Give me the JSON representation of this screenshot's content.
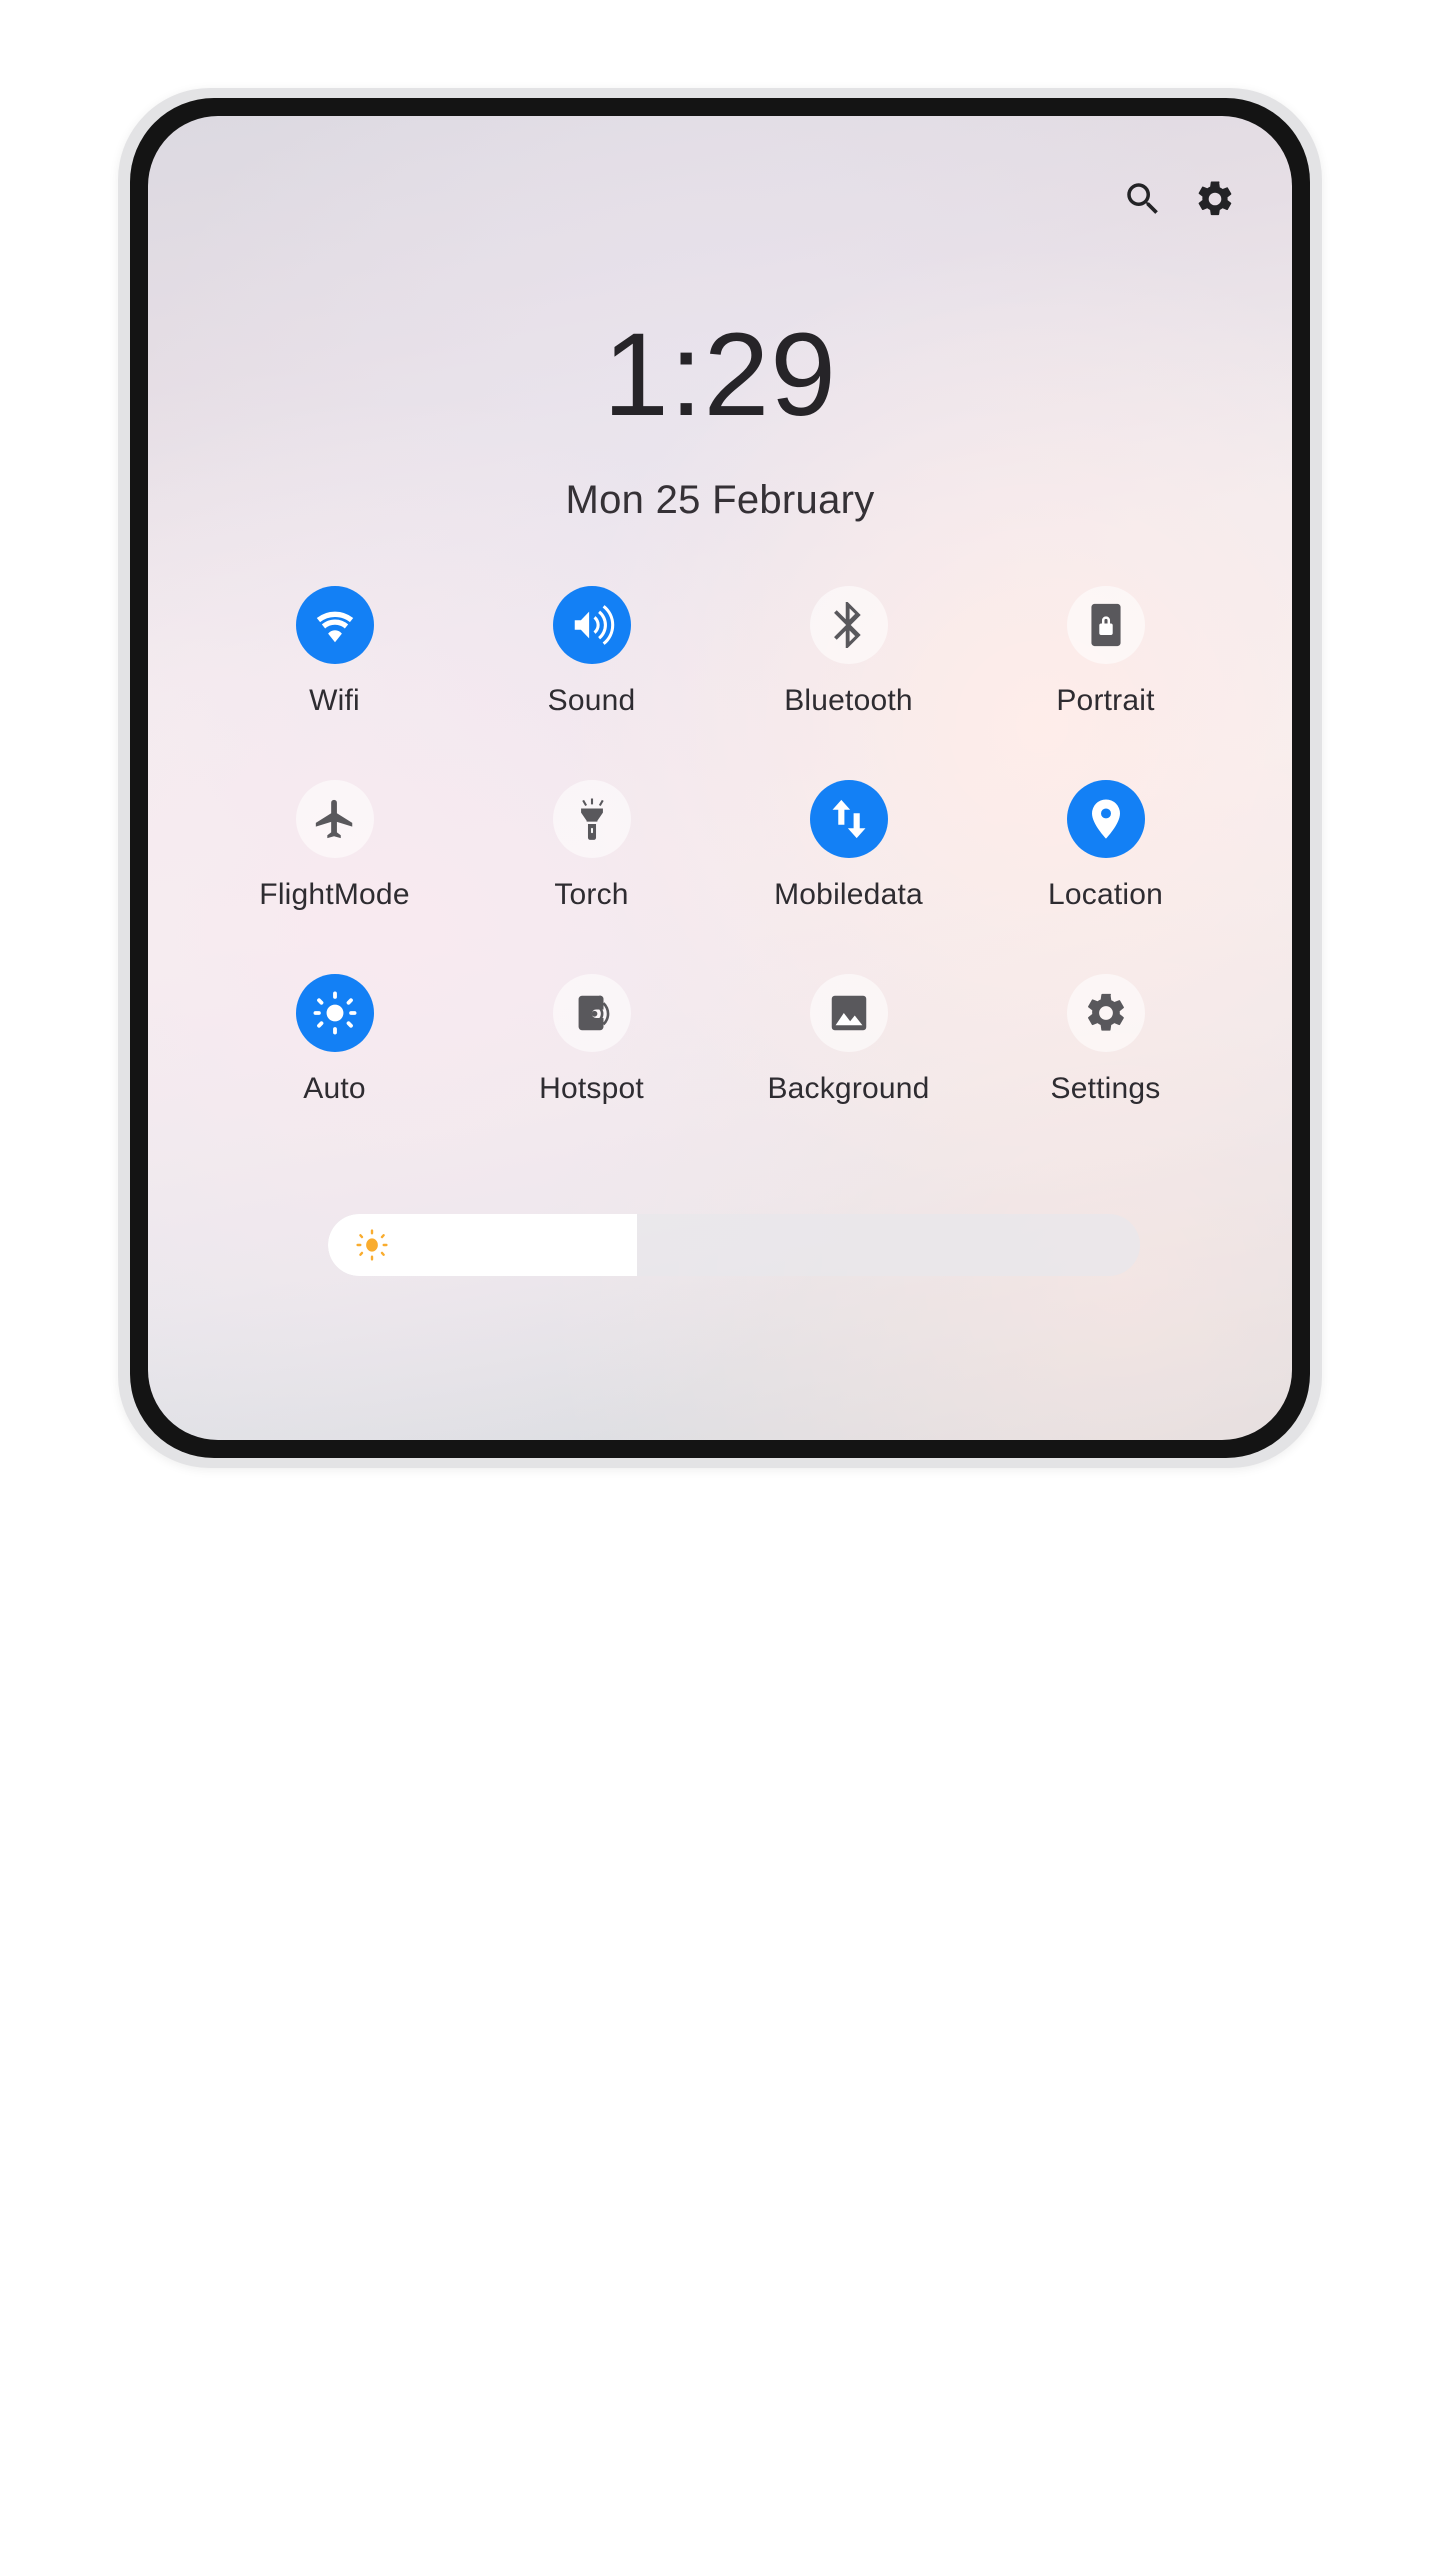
{
  "device": {
    "frame_color": "#e3e3e5",
    "bezel_color": "#141414"
  },
  "screen": {
    "accent_on_color": "#1380f5",
    "icon_off_color": "#59585c",
    "text_color": "#2e2c31",
    "brightness_sun_color": "#f9ac2e"
  },
  "status_bar": {
    "icons": [
      {
        "name": "search-icon",
        "label": "Search"
      },
      {
        "name": "gear-icon",
        "label": "Settings"
      }
    ]
  },
  "clock": {
    "time": "1:29",
    "date": "Mon 25 February"
  },
  "quick_settings": {
    "tiles": [
      {
        "label": "Wifi",
        "icon": "wifi-icon",
        "state": "on"
      },
      {
        "label": "Sound",
        "icon": "volume-icon",
        "state": "on"
      },
      {
        "label": "Bluetooth",
        "icon": "bluetooth-icon",
        "state": "off"
      },
      {
        "label": "Portrait",
        "icon": "screen-lock-icon",
        "state": "off"
      },
      {
        "label": "FlightMode",
        "icon": "airplane-icon",
        "state": "off"
      },
      {
        "label": "Torch",
        "icon": "flashlight-icon",
        "state": "off"
      },
      {
        "label": "Mobiledata",
        "icon": "data-arrows-icon",
        "state": "on"
      },
      {
        "label": "Location",
        "icon": "location-pin-icon",
        "state": "on"
      },
      {
        "label": "Auto",
        "icon": "brightness-icon",
        "state": "on"
      },
      {
        "label": "Hotspot",
        "icon": "hotspot-icon",
        "state": "off"
      },
      {
        "label": "Background",
        "icon": "image-icon",
        "state": "off"
      },
      {
        "label": "Settings",
        "icon": "gear-icon",
        "state": "off"
      }
    ]
  },
  "brightness": {
    "icon": "sun-icon",
    "value_percent": 38
  }
}
